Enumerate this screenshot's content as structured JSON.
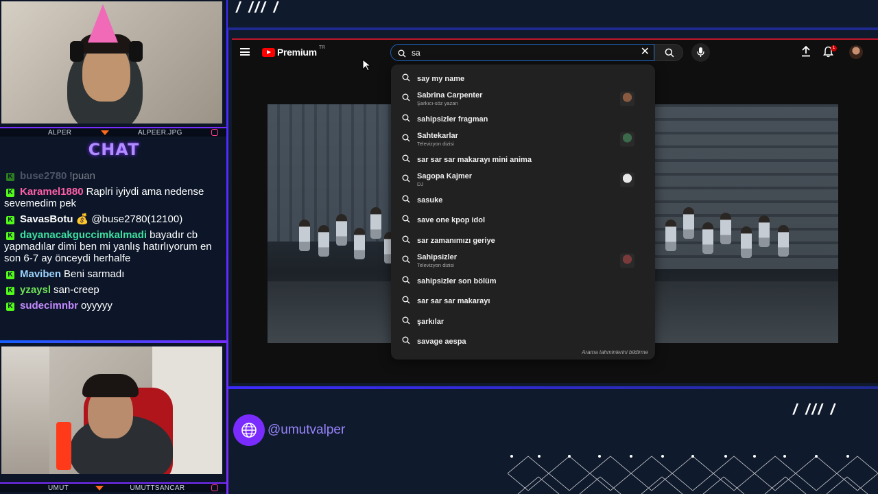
{
  "cams": {
    "top_left_label": "ALPER",
    "top_right_label": "ALPEER.JPG",
    "bottom_left_label": "UMUT",
    "bottom_right_label": "UMUTTSANCAR"
  },
  "chat": {
    "title": "CHAT",
    "messages": [
      {
        "user": "buse2780",
        "text": "!puan",
        "color": "#9aa3b5",
        "faded": true
      },
      {
        "user": "Karamel1880",
        "text": "Raplri iyiydi ama nedense sevemedim pek",
        "color": "#ff5fa8"
      },
      {
        "user": "SavasBotu",
        "text": "💰 @buse2780(12100)",
        "color": "#ffffff"
      },
      {
        "user": "dayanacakguccimkalmadi",
        "text": "bayadır cb yapmadılar dimi ben mi yanlış hatırlıyorum en son 6-7 ay önceydi herhalfe",
        "color": "#3fe0a0"
      },
      {
        "user": "Maviben",
        "text": "Beni sarmadı",
        "color": "#9ed4ff"
      },
      {
        "user": "yzaysl",
        "text": "san-creep",
        "color": "#6fe05a"
      },
      {
        "user": "sudecimnbr",
        "text": "oyyyyy",
        "color": "#c58bff"
      }
    ]
  },
  "overlay": {
    "slashes_top": "/ /// /",
    "slashes_right": "/ /// /",
    "handle": "@umutvalper"
  },
  "youtube": {
    "logo_text": "Premium",
    "logo_sup": "TR",
    "search": {
      "value": "sa"
    },
    "notifications_badge": "1",
    "suggestions": [
      {
        "text": "say my name"
      },
      {
        "text": "Sabrina Carpenter",
        "sub": "Şarkıcı-söz yazarı",
        "thumb": "#8a5a40"
      },
      {
        "text": "sahipsizler fragman"
      },
      {
        "text": "Sahtekarlar",
        "sub": "Televizyon dizisi",
        "thumb": "#3b6a4a"
      },
      {
        "text": "sar sar sar makarayı mini anima"
      },
      {
        "text": "Sagopa Kajmer",
        "sub": "DJ",
        "thumb": "#e8e8e8"
      },
      {
        "text": "sasuke"
      },
      {
        "text": "save one kpop idol"
      },
      {
        "text": "sar zamanımızı geriye"
      },
      {
        "text": "Sahipsizler",
        "sub": "Televizyon dizisi",
        "thumb": "#7a3a3a"
      },
      {
        "text": "sahipsizler son bölüm"
      },
      {
        "text": "sar sar sar makarayı"
      },
      {
        "text": "şarkılar"
      },
      {
        "text": "savage aespa"
      }
    ],
    "footer": "Arama tahminlerini bildirme"
  }
}
